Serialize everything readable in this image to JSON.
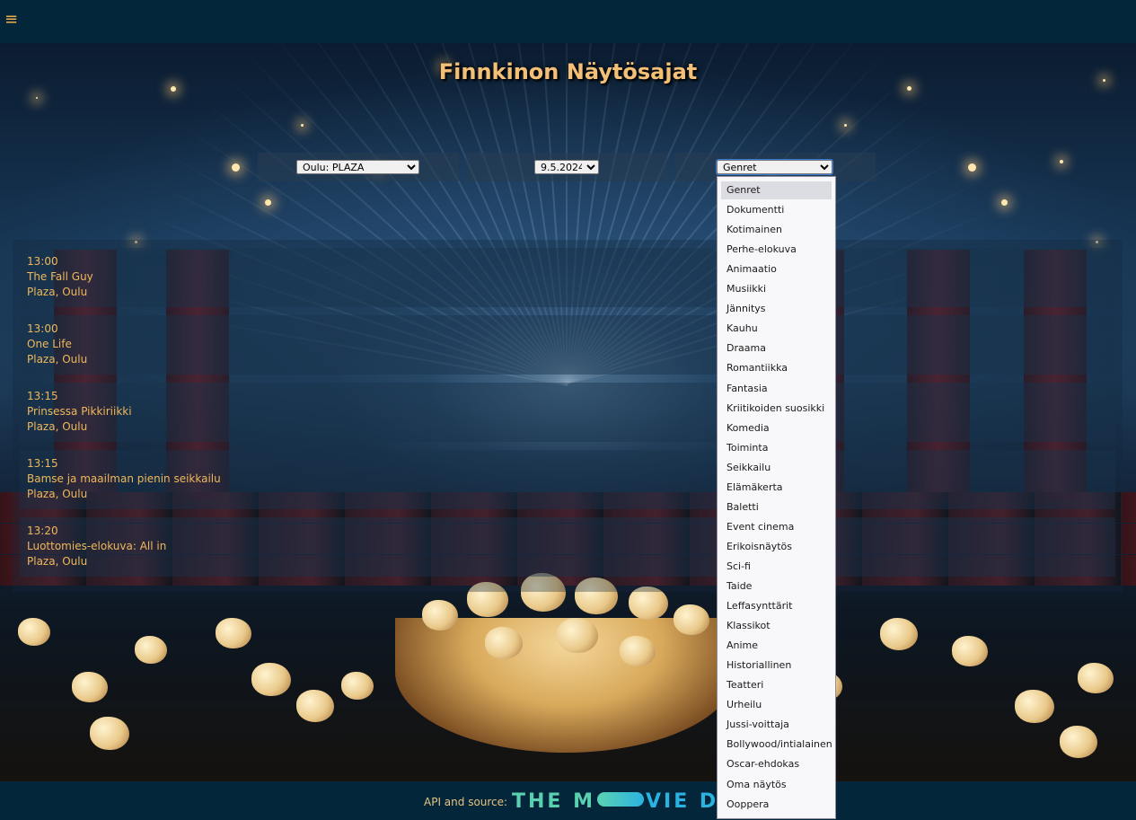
{
  "header": {
    "menu_icon": "hamburger-icon",
    "menu_glyph": "≡"
  },
  "title": "Finnkinon Näytösajat",
  "filters": {
    "theater": "Oulu: PLAZA",
    "date": "9.5.2024",
    "genre": "Genret"
  },
  "showtimes": [
    {
      "time": "13:00",
      "movie": "The Fall Guy",
      "theater": "Plaza, Oulu"
    },
    {
      "time": "13:00",
      "movie": "One Life",
      "theater": "Plaza, Oulu"
    },
    {
      "time": "13:15",
      "movie": "Prinsessa Pikkiriikki",
      "theater": "Plaza, Oulu"
    },
    {
      "time": "13:15",
      "movie": "Bamse ja maailman pienin seikkailu",
      "theater": "Plaza, Oulu"
    },
    {
      "time": "13:20",
      "movie": "Luottomies-elokuva: All in",
      "theater": "Plaza, Oulu"
    }
  ],
  "genre_options": [
    "Genret",
    "Dokumentti",
    "Kotimainen",
    "Perhe-elokuva",
    "Animaatio",
    "Musiikki",
    "Jännitys",
    "Kauhu",
    "Draama",
    "Romantiikka",
    "Fantasia",
    "Kriitikoiden suosikki",
    "Komedia",
    "Toiminta",
    "Seikkailu",
    "Elämäkerta",
    "Baletti",
    "Event cinema",
    "Erikoisnäytös",
    "Sci-fi",
    "Taide",
    "Leffasynttärit",
    "Klassikot",
    "Anime",
    "Historiallinen",
    "Teatteri",
    "Urheilu",
    "Jussi-voittaja",
    "Bollywood/intialainen",
    "Oscar-ehdokas",
    "Oma näytös",
    "Ooppera"
  ],
  "selected_genre_index": 0,
  "footer": {
    "api_label": "API and source:",
    "logo_left": "THE M",
    "logo_right": "VIE DB",
    "logo_colors": [
      "#5cd2b2",
      "#2ab3e0"
    ]
  }
}
